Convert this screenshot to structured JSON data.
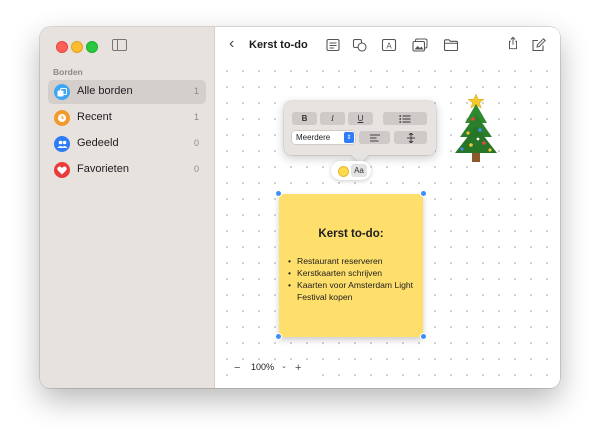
{
  "sidebar": {
    "section_title": "Borden",
    "items": [
      {
        "label": "Alle borden",
        "count": "1",
        "icon": "boards-icon",
        "color": "#3ea7f2"
      },
      {
        "label": "Recent",
        "count": "1",
        "icon": "clock-icon",
        "color": "#f39a2e"
      },
      {
        "label": "Gedeeld",
        "count": "0",
        "icon": "people-icon",
        "color": "#2f7cf6"
      },
      {
        "label": "Favorieten",
        "count": "0",
        "icon": "heart-icon",
        "color": "#ea3b3b"
      }
    ]
  },
  "toolbar": {
    "title": "Kerst to-do",
    "icons": [
      "back-chevron-icon",
      "note-icon",
      "shapes-icon",
      "text-box-icon",
      "media-icon",
      "folder-icon",
      "share-icon",
      "compose-icon"
    ]
  },
  "format_popover": {
    "bold": "B",
    "italic": "I",
    "underline": "U",
    "style_value": "Meerdere",
    "font_chip": "Aa",
    "note_color": "#fcd94d"
  },
  "sticky_note": {
    "title": "Kerst to-do:",
    "items": [
      "Restaurant reserveren",
      "Kerstkaarten schrijven",
      "Kaarten voor Amsterdam Light Festival kopen"
    ],
    "color": "#ffdf6b"
  },
  "zoom": {
    "minus": "−",
    "value": "100%",
    "plus": "+"
  },
  "decorations": {
    "christmas_tree": "christmas-tree-icon"
  },
  "colors": {
    "accent": "#2f7cf6",
    "sidebar_bg": "#e8e2df",
    "selection_handle": "#3a8ff8"
  }
}
